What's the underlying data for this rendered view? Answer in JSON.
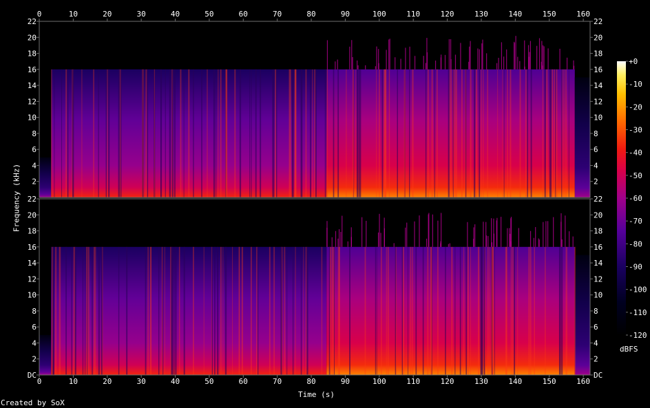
{
  "chart_data": {
    "type": "heatmap",
    "subtype": "spectrogram",
    "channels": 2,
    "xlabel": "Time (s)",
    "ylabel": "Frequency (kHz)",
    "xlim": [
      0,
      162
    ],
    "ylim": [
      0,
      22
    ],
    "x_ticks": [
      "0",
      "10",
      "20",
      "30",
      "40",
      "50",
      "60",
      "70",
      "80",
      "90",
      "100",
      "110",
      "120",
      "130",
      "140",
      "150",
      "160"
    ],
    "y_ticks": [
      "DC",
      "2",
      "4",
      "6",
      "8",
      "10",
      "12",
      "14",
      "16",
      "18",
      "20",
      "22"
    ],
    "colorbar": {
      "label": "dBFS",
      "range": [
        -120,
        0
      ],
      "ticks": [
        "+0",
        "-10",
        "-20",
        "-30",
        "-40",
        "-50",
        "-60",
        "-70",
        "-80",
        "-90",
        "-100",
        "-110",
        "-120"
      ]
    },
    "segments": [
      {
        "t_start": 0,
        "t_end": 3.5,
        "cutoff_khz": 5,
        "level_db": -95
      },
      {
        "t_start": 3.5,
        "t_end": 84.5,
        "cutoff_khz": 16,
        "level_db": -72
      },
      {
        "t_start": 84.5,
        "t_end": 157.5,
        "cutoff_khz": 16,
        "level_db": -58
      },
      {
        "t_start": 157.5,
        "t_end": 162,
        "cutoff_khz": 15,
        "level_db": -95
      }
    ],
    "colors": {
      "background": "#000000",
      "frame": "#707070",
      "text": "#ffffff"
    }
  },
  "footer": {
    "credit": "Created by SoX"
  }
}
